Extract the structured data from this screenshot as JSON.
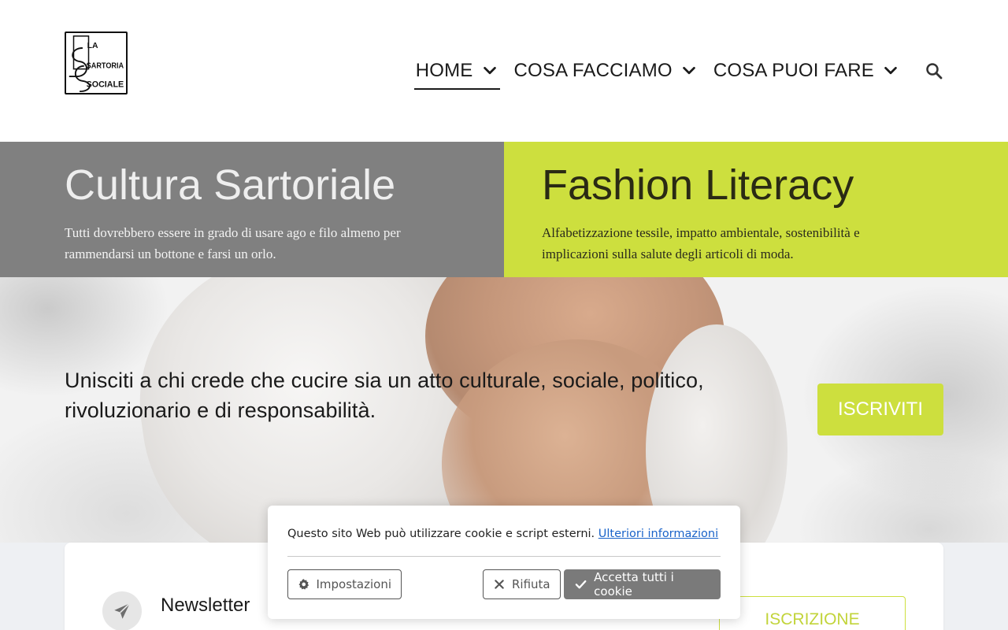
{
  "logo": {
    "text_lines": [
      "LA",
      "SARTORIA",
      "SOCIALE"
    ],
    "alt": "La Sartoria Sociale"
  },
  "nav": {
    "items": [
      {
        "label": "HOME",
        "active": true
      },
      {
        "label": "COSA FACCIAMO",
        "active": false
      },
      {
        "label": "COSA PUOI FARE",
        "active": false
      }
    ],
    "search_icon": "search-icon",
    "chevron_icon": "chevron-down-icon"
  },
  "split": {
    "left": {
      "title": "Cultura Sartoriale",
      "text": "Tutti dovrebbero essere in grado di usare ago e filo almeno per rammendarsi un bottone e farsi un orlo."
    },
    "right": {
      "title": "Fashion Literacy",
      "text": "Alfabetizzazione tessile, impatto ambientale, sostenibilità e implicazioni sulla salute degli articoli di moda."
    }
  },
  "hero": {
    "text": "Unisciti a chi crede che cucire sia un atto culturale, sociale, politico, rivoluzionario e di responsabilità.",
    "cta": "ISCRIVITI"
  },
  "newsletter": {
    "title": "Newsletter",
    "icon": "paper-plane-icon",
    "button": "ISCRIZIONE"
  },
  "cookie": {
    "text": "Questo sito Web può utilizzare cookie e script esterni.",
    "link": "Ulteriori informazioni",
    "settings": "Impostazioni",
    "reject": "Rifiuta",
    "accept": "Accetta tutti i cookie"
  },
  "colors": {
    "accent": "#cddf3e",
    "gray_panel": "#808080",
    "text": "#1a1a1a",
    "link": "#1a63c9",
    "accept_bg": "#7a7a7a"
  }
}
